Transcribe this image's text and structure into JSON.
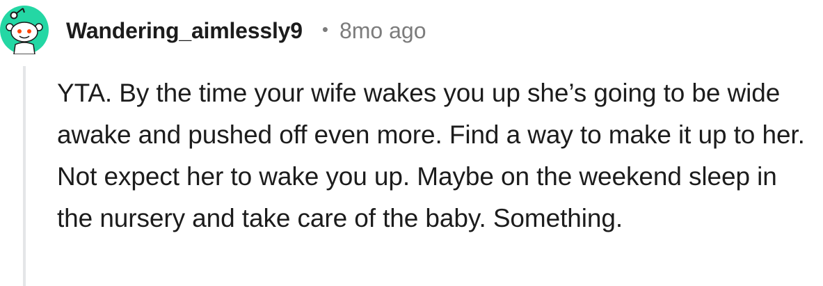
{
  "comment": {
    "author": "Wandering_aimlessly9",
    "separator": "•",
    "timestamp": "8mo ago",
    "avatar_icon": "snoo-avatar-icon",
    "avatar_color": "#24d7a4",
    "body": "YTA. By the time your wife wakes you up she’s going to be wide awake and pushed off even more. Find a way to make it up to her. Not expect her to wake you up. Maybe on the weekend sleep in the nursery and take care of the baby. Something."
  },
  "colors": {
    "text_primary": "#1c1c1c",
    "text_secondary": "#7c7c7c",
    "thread_line": "#e4e6e8"
  }
}
